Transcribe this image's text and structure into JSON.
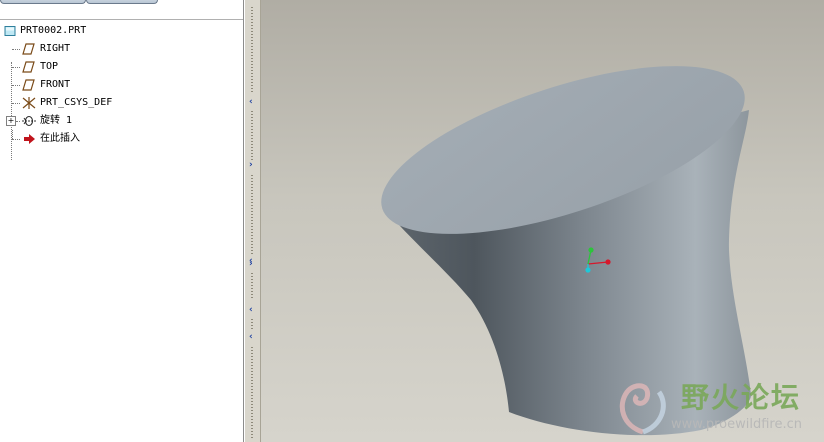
{
  "model_tree": {
    "items": [
      {
        "label": "PRT0002.PRT",
        "icon": "part-icon",
        "expandable": false
      },
      {
        "label": "RIGHT",
        "icon": "datum-plane-icon",
        "expandable": false
      },
      {
        "label": "TOP",
        "icon": "datum-plane-icon",
        "expandable": false
      },
      {
        "label": "FRONT",
        "icon": "datum-plane-icon",
        "expandable": false
      },
      {
        "label": "PRT_CSYS_DEF",
        "icon": "csys-icon",
        "expandable": false
      },
      {
        "label": "旋转 1",
        "icon": "revolve-icon",
        "expandable": true,
        "expander_symbol": "+"
      },
      {
        "label": "在此插入",
        "icon": "insert-here-arrow-icon",
        "expandable": false
      }
    ]
  },
  "splitter": {
    "arrows": [
      "‹",
      "›",
      "‹",
      "›",
      "‹",
      "‹"
    ]
  },
  "watermark": {
    "title": "野火论坛",
    "url": "www.proewildfire.cn"
  },
  "colors": {
    "model_surface": "#8f98a0",
    "model_top_face": "#9aa4ac",
    "csys_x": "#d6182c",
    "csys_y": "#2cc43c",
    "csys_z": "#1ec8d8",
    "watermark": "#7aa85a"
  }
}
